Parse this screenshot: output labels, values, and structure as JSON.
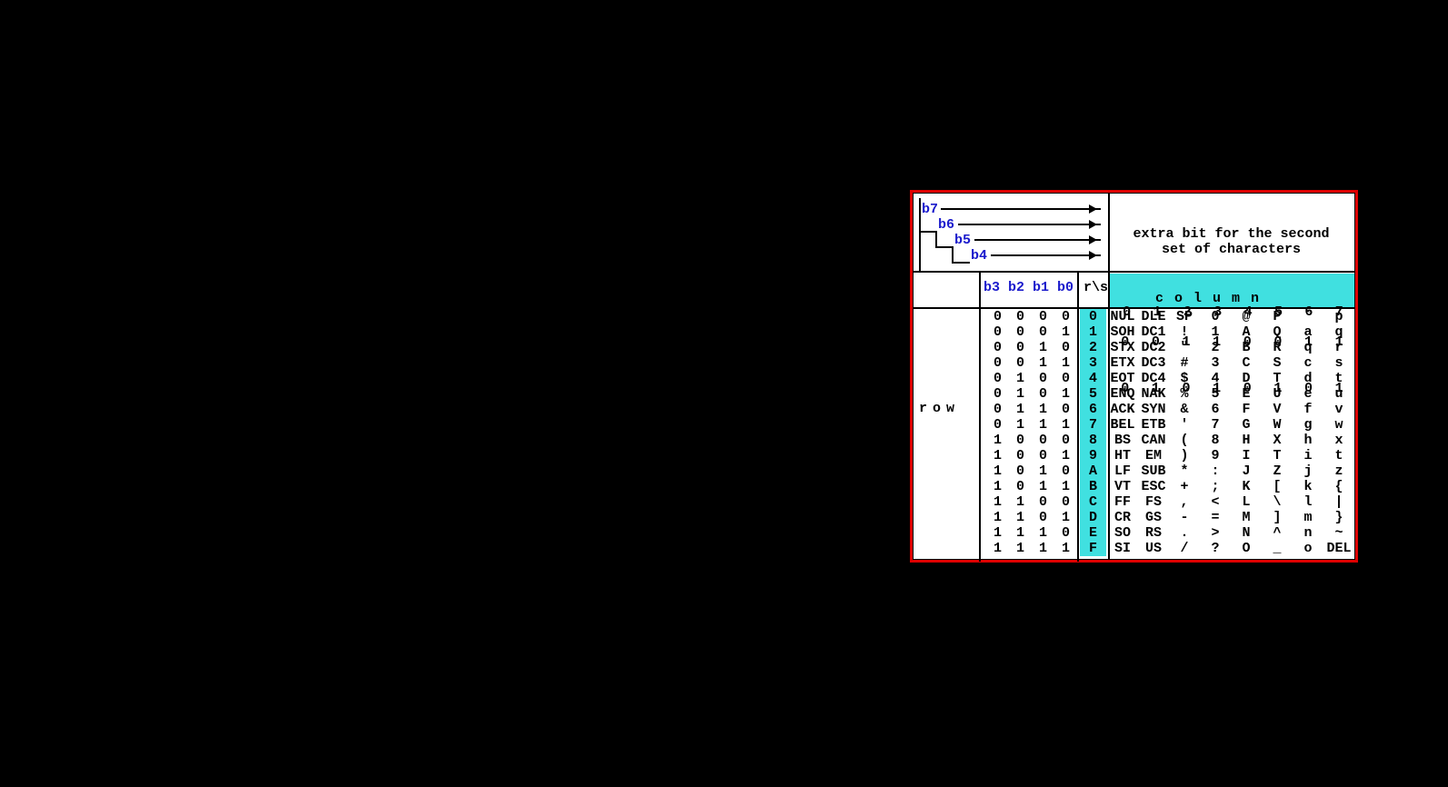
{
  "title": "extra bit for the second\nset of characters",
  "bit_labels_high": [
    "b7",
    "b6",
    "b5",
    "b4"
  ],
  "bit_labels_low": "b3 b2 b1 b0",
  "rs_label": "r\\s",
  "row_word": "row",
  "column_word": "column",
  "high_bits": {
    "b6": [
      "0",
      "0",
      "0",
      "0",
      "1",
      "1",
      "1",
      "1"
    ],
    "b5": [
      "0",
      "0",
      "1",
      "1",
      "0",
      "0",
      "1",
      "1"
    ],
    "b4": [
      "0",
      "1",
      "0",
      "1",
      "0",
      "1",
      "0",
      "1"
    ]
  },
  "col_headers": [
    "0",
    "1",
    "2",
    "3",
    "4",
    "5",
    "6",
    "7"
  ],
  "rows": [
    {
      "bits": [
        "0",
        "0",
        "0",
        "0"
      ],
      "hex": "0",
      "v": [
        "NUL",
        "DLE",
        "SP",
        "0",
        "@",
        "P",
        "`",
        "p"
      ]
    },
    {
      "bits": [
        "0",
        "0",
        "0",
        "1"
      ],
      "hex": "1",
      "v": [
        "SOH",
        "DC1",
        "!",
        "1",
        "A",
        "Q",
        "a",
        "q"
      ]
    },
    {
      "bits": [
        "0",
        "0",
        "1",
        "0"
      ],
      "hex": "2",
      "v": [
        "STX",
        "DC2",
        "\"",
        "2",
        "B",
        "R",
        "q",
        "r"
      ]
    },
    {
      "bits": [
        "0",
        "0",
        "1",
        "1"
      ],
      "hex": "3",
      "v": [
        "ETX",
        "DC3",
        "#",
        "3",
        "C",
        "S",
        "c",
        "s"
      ]
    },
    {
      "bits": [
        "0",
        "1",
        "0",
        "0"
      ],
      "hex": "4",
      "v": [
        "EOT",
        "DC4",
        "$",
        "4",
        "D",
        "T",
        "d",
        "t"
      ]
    },
    {
      "bits": [
        "0",
        "1",
        "0",
        "1"
      ],
      "hex": "5",
      "v": [
        "ENQ",
        "NAK",
        "%",
        "5",
        "E",
        "U",
        "e",
        "u"
      ]
    },
    {
      "bits": [
        "0",
        "1",
        "1",
        "0"
      ],
      "hex": "6",
      "v": [
        "ACK",
        "SYN",
        "&",
        "6",
        "F",
        "V",
        "f",
        "v"
      ]
    },
    {
      "bits": [
        "0",
        "1",
        "1",
        "1"
      ],
      "hex": "7",
      "v": [
        "BEL",
        "ETB",
        "'",
        "7",
        "G",
        "W",
        "g",
        "w"
      ]
    },
    {
      "bits": [
        "1",
        "0",
        "0",
        "0"
      ],
      "hex": "8",
      "v": [
        "BS",
        "CAN",
        "(",
        "8",
        "H",
        "X",
        "h",
        "x"
      ]
    },
    {
      "bits": [
        "1",
        "0",
        "0",
        "1"
      ],
      "hex": "9",
      "v": [
        "HT",
        "EM",
        ")",
        "9",
        "I",
        "T",
        "i",
        "t"
      ]
    },
    {
      "bits": [
        "1",
        "0",
        "1",
        "0"
      ],
      "hex": "A",
      "v": [
        "LF",
        "SUB",
        "*",
        ":",
        "J",
        "Z",
        "j",
        "z"
      ]
    },
    {
      "bits": [
        "1",
        "0",
        "1",
        "1"
      ],
      "hex": "B",
      "v": [
        "VT",
        "ESC",
        "+",
        ";",
        "K",
        "[",
        "k",
        "{"
      ]
    },
    {
      "bits": [
        "1",
        "1",
        "0",
        "0"
      ],
      "hex": "C",
      "v": [
        "FF",
        "FS",
        ",",
        "<",
        "L",
        "\\",
        "l",
        "|"
      ]
    },
    {
      "bits": [
        "1",
        "1",
        "0",
        "1"
      ],
      "hex": "D",
      "v": [
        "CR",
        "GS",
        "-",
        "=",
        "M",
        "]",
        "m",
        "}"
      ]
    },
    {
      "bits": [
        "1",
        "1",
        "1",
        "0"
      ],
      "hex": "E",
      "v": [
        "SO",
        "RS",
        ".",
        ">",
        "N",
        "^",
        "n",
        "~"
      ]
    },
    {
      "bits": [
        "1",
        "1",
        "1",
        "1"
      ],
      "hex": "F",
      "v": [
        "SI",
        "US",
        "/",
        "?",
        "O",
        "_",
        "o",
        "DEL"
      ]
    }
  ]
}
